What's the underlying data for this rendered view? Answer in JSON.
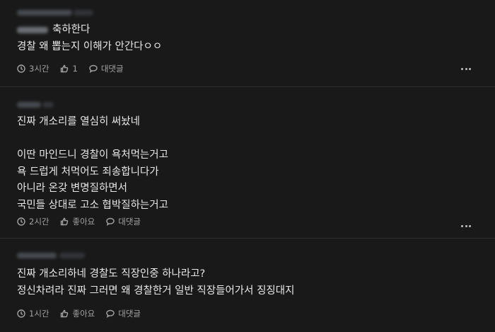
{
  "comments": [
    {
      "lines": [
        "축하한다",
        "경찰 왜 뽑는지 이해가 안간다ㅇㅇ"
      ],
      "time": "3시간",
      "likes": "1",
      "reply": "대댓글"
    },
    {
      "lines": [
        "진짜 개소리를 열심히 써놨네",
        "",
        "이딴 마인드니 경찰이 욕처먹는거고",
        "욕 드럽게 처먹어도 죄송합니다가",
        "아니라 온갖 변명질하면서",
        "국민들 상대로 고소 협박질하는거고"
      ],
      "time": "2시간",
      "likes": "좋아요",
      "reply": "대댓글"
    },
    {
      "lines": [
        "진짜 개소리하네 경찰도 직장인중 하나라고?",
        "정신차려라 진짜 그러면 왜 경찰한거 일반 직장들어가서 징징대지"
      ],
      "time": "1시간",
      "likes": "좋아요",
      "reply": "대댓글"
    }
  ],
  "icons": {
    "time": "clock-icon",
    "like": "thumbs-up-icon",
    "reply": "speech-bubble-icon",
    "more": "more-dots-icon"
  }
}
